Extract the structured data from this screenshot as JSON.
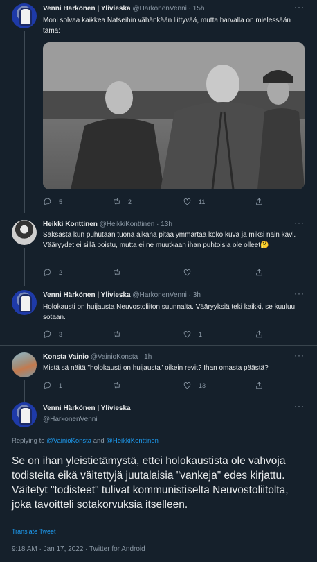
{
  "tweets": [
    {
      "name": "Venni Härkönen | Ylivieska",
      "handle": "@HarkonenVenni",
      "time": "15h",
      "text": "Moni solvaa kaikkea Natseihin vähänkään liittyvää, mutta harvalla on mielessään tämä:",
      "replies": "5",
      "retweets": "2",
      "likes": "11"
    },
    {
      "name": "Heikki Konttinen",
      "handle": "@HeikkiKonttinen",
      "time": "13h",
      "text": "Saksasta kun puhutaan tuona aikana pitää ymmärtää koko kuva ja miksi näin kävi. Vääryydet ei sillä poistu, mutta ei ne muutkaan ihan puhtoisia ole olleet🤔",
      "replies": "2",
      "retweets": "",
      "likes": ""
    },
    {
      "name": "Venni Härkönen | Ylivieska",
      "handle": "@HarkonenVenni",
      "time": "3h",
      "text": "Holokausti on huijausta Neuvostoliiton suunnalta. Vääryyksiä teki kaikki, se kuuluu sotaan.",
      "replies": "3",
      "retweets": "",
      "likes": "1"
    },
    {
      "name": "Konsta Vainio",
      "handle": "@VainioKonsta",
      "time": "1h",
      "text": "Mistä sä näitä \"holokausti on huijausta\" oikein revit? Ihan omasta päästä?",
      "replies": "1",
      "retweets": "",
      "likes": "13"
    }
  ],
  "main": {
    "name": "Venni Härkönen | Ylivieska",
    "handle": "@HarkonenVenni",
    "replying_prefix": "Replying to",
    "replying_to_1": "@VainioKonsta",
    "replying_and": "and",
    "replying_to_2": "@HeikkiKonttinen",
    "text": "Se on ihan yleistietämystä, ettei holokaustista ole vahvoja todisteita eikä väitettyjä juutalaisia \"vankeja\" edes kirjattu. Väitetyt \"todisteet\" tulivat kommunistiselta Neuvostoliitolta, joka tavoitteli sotakorvuksia itselleen.",
    "translate": "Translate Tweet",
    "meta": "9:18 AM · Jan 17, 2022 · Twitter for Android"
  },
  "dot_sep": "·",
  "icons": {
    "reply": "reply-icon",
    "retweet": "retweet-icon",
    "like": "heart-icon",
    "share": "share-icon",
    "more": "more-icon"
  },
  "colors": {
    "background": "#15202b",
    "text": "#e7e9ea",
    "muted": "#8b98a5",
    "accent": "#1d9bf0",
    "divider": "#38444d"
  }
}
